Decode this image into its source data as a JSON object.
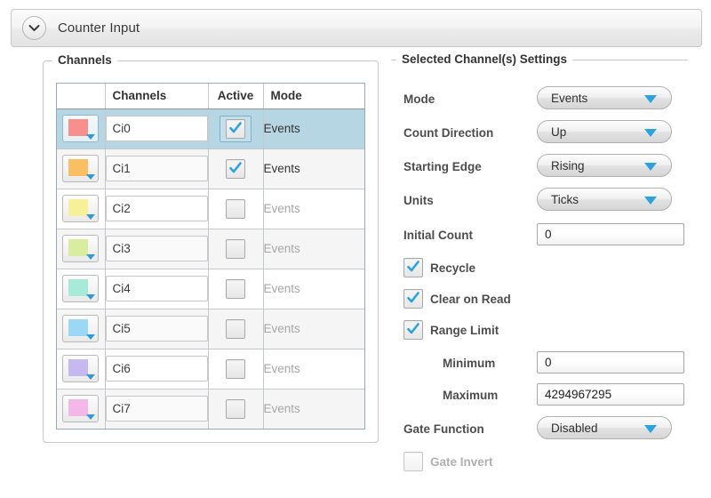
{
  "header": {
    "title": "Counter Input",
    "collapse_icon": "chevron-down-icon"
  },
  "channels_group": {
    "legend": "Channels",
    "columns": [
      "",
      "Channels",
      "Active",
      "Mode"
    ],
    "rows": [
      {
        "color": "#f98e8e",
        "name": "Ci0",
        "active": true,
        "mode": "Events",
        "selected": true
      },
      {
        "color": "#f9bf62",
        "name": "Ci1",
        "active": true,
        "mode": "Events",
        "selected": false
      },
      {
        "color": "#f7f09b",
        "name": "Ci2",
        "active": false,
        "mode": "Events",
        "selected": false
      },
      {
        "color": "#d8eda0",
        "name": "Ci3",
        "active": false,
        "mode": "Events",
        "selected": false
      },
      {
        "color": "#a8ead8",
        "name": "Ci4",
        "active": false,
        "mode": "Events",
        "selected": false
      },
      {
        "color": "#9bd8f5",
        "name": "Ci5",
        "active": false,
        "mode": "Events",
        "selected": false
      },
      {
        "color": "#c6b8f0",
        "name": "Ci6",
        "active": false,
        "mode": "Events",
        "selected": false
      },
      {
        "color": "#f5b6e8",
        "name": "Ci7",
        "active": false,
        "mode": "Events",
        "selected": false
      }
    ]
  },
  "settings_group": {
    "legend": "Selected Channel(s) Settings",
    "mode": {
      "label": "Mode",
      "value": "Events"
    },
    "count_direction": {
      "label": "Count Direction",
      "value": "Up"
    },
    "starting_edge": {
      "label": "Starting Edge",
      "value": "Rising"
    },
    "units": {
      "label": "Units",
      "value": "Ticks"
    },
    "initial_count": {
      "label": "Initial Count",
      "value": "0"
    },
    "recycle": {
      "label": "Recycle",
      "checked": true
    },
    "clear_on_read": {
      "label": "Clear on Read",
      "checked": true
    },
    "range_limit": {
      "label": "Range Limit",
      "checked": true
    },
    "minimum": {
      "label": "Minimum",
      "value": "0"
    },
    "maximum": {
      "label": "Maximum",
      "value": "4294967295"
    },
    "gate_function": {
      "label": "Gate Function",
      "value": "Disabled"
    },
    "gate_invert": {
      "label": "Gate Invert",
      "checked": false,
      "enabled": false
    }
  },
  "colors": {
    "accent_blue": "#2aa3e0",
    "selection_blue": "#b7d6e4",
    "border_grey": "#c8c8c8",
    "text_dark": "#333333",
    "text_dim": "#a6a6a6"
  }
}
